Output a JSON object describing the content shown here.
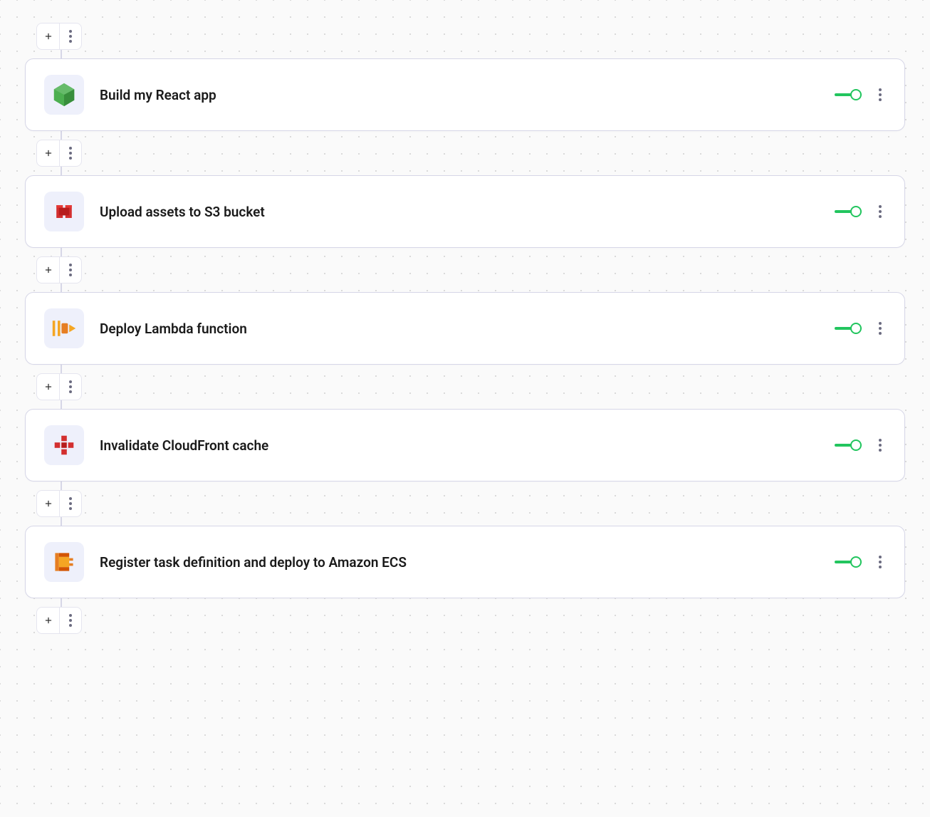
{
  "colors": {
    "toggle_on": "#22c55e",
    "icon_green": "#4caf50",
    "icon_red": "#d32f2f",
    "icon_orange": "#f5a623",
    "icon_orange2": "#e67e22"
  },
  "steps": [
    {
      "title": "Build my React app",
      "icon": "node",
      "enabled": true
    },
    {
      "title": "Upload assets to S3 bucket",
      "icon": "s3",
      "enabled": true
    },
    {
      "title": "Deploy Lambda function",
      "icon": "lambda",
      "enabled": true
    },
    {
      "title": "Invalidate CloudFront cache",
      "icon": "cloudfront",
      "enabled": true
    },
    {
      "title": "Register task definition and deploy to Amazon ECS",
      "icon": "ecs",
      "enabled": true
    }
  ]
}
